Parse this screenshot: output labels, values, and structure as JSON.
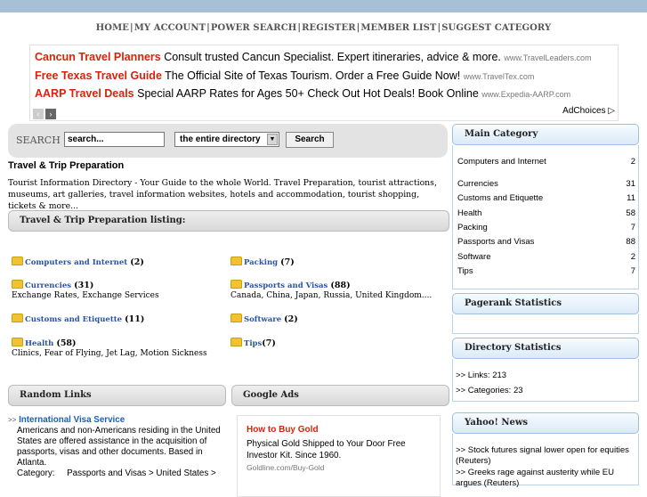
{
  "nav": {
    "items": [
      "HOME",
      "MY ACCOUNT",
      "POWER SEARCH",
      "REGISTER",
      "MEMBER LIST",
      "SUGGEST CATEGORY"
    ],
    "separator": "|"
  },
  "ads": {
    "items": [
      {
        "title": "Cancun Travel Planners",
        "desc": "Consult trusted Cancun Specialist. Expert itineraries, advice & more.",
        "url": "www.TravelLeaders.com"
      },
      {
        "title": "Free Texas Travel Guide",
        "desc": "The Official Site of Texas Tourism. Order a Free Guide Now!",
        "url": "www.TravelTex.com"
      },
      {
        "title": "AARP Travel Deals",
        "desc": "Special AARP Rates for Ages 50+ Check Out Hot Deals! Book Online",
        "url": "www.Expedia-AARP.com"
      }
    ],
    "prev": "‹",
    "next": "›",
    "adchoices": "AdChoices ▷"
  },
  "search": {
    "label": "SEARCH",
    "input_value": "search...",
    "select_value": "the entire directory",
    "select_arrow": "▼",
    "button": "Search"
  },
  "page": {
    "title": "Travel & Trip Preparation",
    "description": "Tourist Information Directory - Your Guide to the whole World. Travel Preparation, tourist attractions, museums, art galleries, travel information websites, hotels and accommodation, tourist shopping, tickets & more..."
  },
  "listing_header": "Travel & Trip Preparation listing:",
  "categories": [
    {
      "name": "Computers and Internet",
      "count": "(2)",
      "sub": ""
    },
    {
      "name": "Packing",
      "count": "(7)",
      "sub": ""
    },
    {
      "name": "Currencies",
      "count": "(31)",
      "sub": "Exchange Rates, Exchange Services"
    },
    {
      "name": "Passports and Visas",
      "count": "(88)",
      "sub": "Canada, China, Japan, Russia, United Kingdom...."
    },
    {
      "name": "Customs and Etiquette",
      "count": "(11)",
      "sub": ""
    },
    {
      "name": "Software",
      "count": "(2)",
      "sub": ""
    },
    {
      "name": "Health",
      "count": "(58)",
      "sub": "Clinics, Fear of Flying, Jet Lag, Motion Sickness"
    },
    {
      "name": "Tips",
      "count": "(7)",
      "sub": ""
    }
  ],
  "random_links": {
    "header": "Random Links",
    "marker": ">>",
    "title": "International Visa Service",
    "desc": "Americans and non-Americans residing in the United States are offered assistance in the acquisition of passports, visas and other documents. Based in Atlanta.",
    "category_label": "Category:",
    "category_value": "Passports and Visas > United States >"
  },
  "google_ads": {
    "header": "Google Ads",
    "title": "How to Buy Gold",
    "desc": "Physical Gold Shipped to Your Door Free Investor Kit. Since 1960.",
    "url": "Goldline.com/Buy-Gold"
  },
  "sidebar": {
    "main_category": {
      "header": "Main Category",
      "items": [
        {
          "name": "Computers and Internet",
          "count": "2"
        },
        {
          "name": "Currencies",
          "count": "31"
        },
        {
          "name": "Customs and Etiquette",
          "count": "11"
        },
        {
          "name": "Health",
          "count": "58"
        },
        {
          "name": "Packing",
          "count": "7"
        },
        {
          "name": "Passports and Visas",
          "count": "88"
        },
        {
          "name": "Software",
          "count": "2"
        },
        {
          "name": "Tips",
          "count": "7"
        }
      ]
    },
    "pagerank": {
      "header": "Pagerank Statistics"
    },
    "directory_stats": {
      "header": "Directory Statistics",
      "links": ">> Links: 213",
      "categories": ">> Categories: 23"
    },
    "yahoo_news": {
      "header": "Yahoo! News",
      "items": [
        ">> Stock futures signal lower open for equities (Reuters)",
        ">> Greeks rage against austerity while EU argues (Reuters)"
      ]
    }
  }
}
